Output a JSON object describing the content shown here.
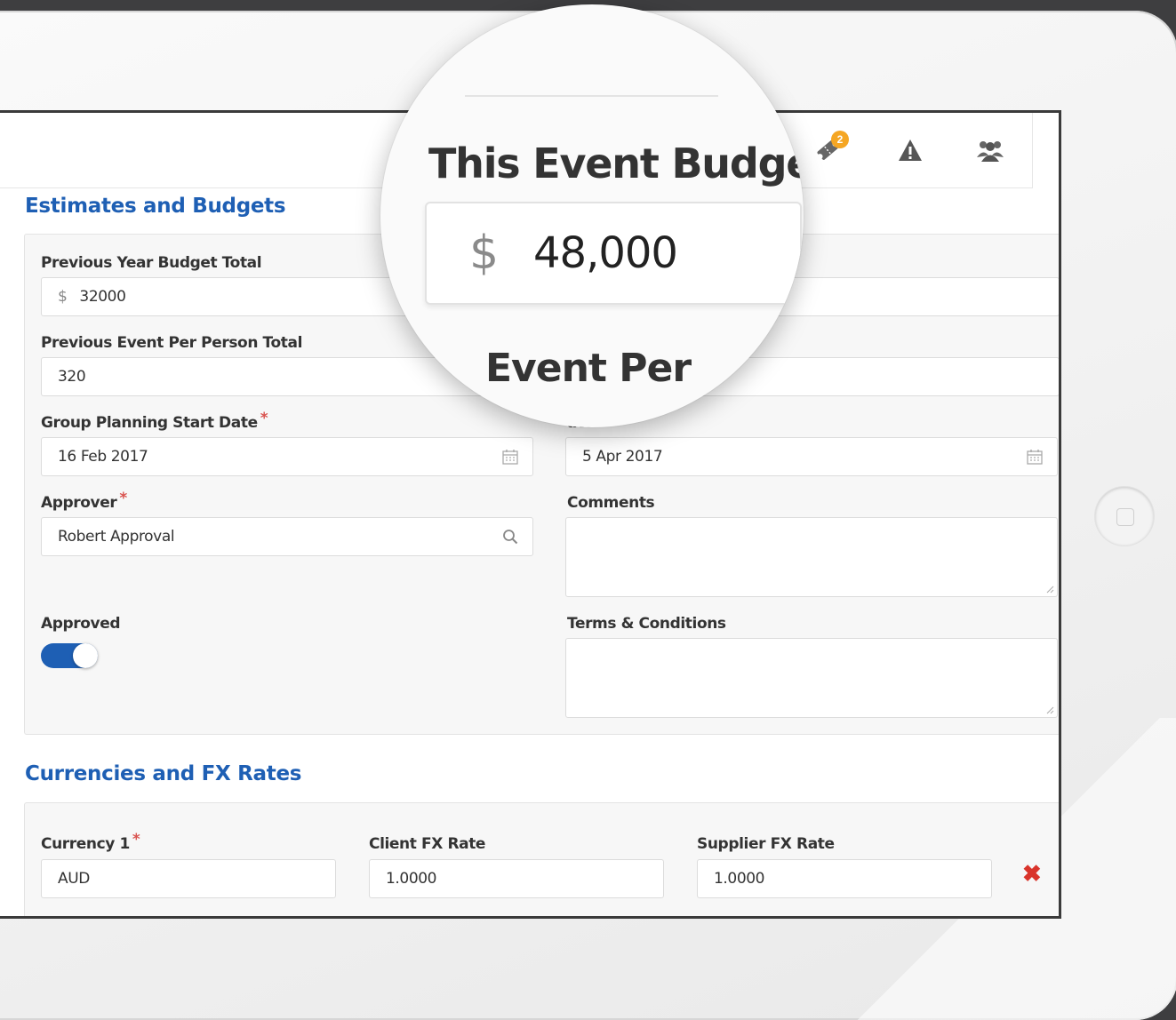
{
  "header": {
    "tickets_badge": "2",
    "icons": [
      "ticket-icon",
      "warning-icon",
      "users-icon"
    ]
  },
  "estimates": {
    "title": "Estimates and Budgets",
    "prev_year_label": "Previous Year Budget Total",
    "prev_year_currency": "$",
    "prev_year_value": "32000",
    "prev_event_pp_label": "Previous Event Per Person Total",
    "prev_event_pp_value": "320",
    "start_date_label": "Group Planning Start Date",
    "start_date_value": "16 Feb 2017",
    "end_date_label_partial": "ate",
    "end_date_value": "5 Apr 2017",
    "approver_label": "Approver",
    "approver_value": "Robert Approval",
    "comments_label": "Comments",
    "approved_label": "Approved",
    "approved_on": true,
    "terms_label": "Terms & Conditions",
    "required_mark": "*"
  },
  "currencies": {
    "title": "Currencies and FX Rates",
    "currency_label": "Currency 1",
    "currency_value": "AUD",
    "client_fx_label": "Client FX Rate",
    "client_fx_value": "1.0000",
    "supplier_fx_label": "Supplier FX Rate",
    "supplier_fx_value": "1.0000",
    "remove_symbol": "✖"
  },
  "magnifier": {
    "title": "This Event Budget",
    "currency": "$",
    "value": "48,000",
    "next_label_partial": "Event Per"
  },
  "colors": {
    "accent": "#1e5fb4",
    "required": "#d9534f",
    "badge": "#f5a623",
    "remove": "#d9342b"
  }
}
